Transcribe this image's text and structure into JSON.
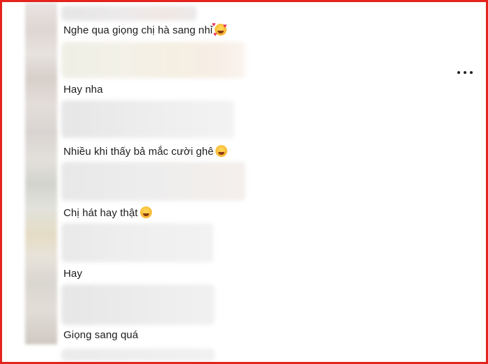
{
  "comments": [
    {
      "text": "Nghe qua giọng chị hà sang nhỉ",
      "emoji": "smiling-face-with-hearts-emoji"
    },
    {
      "text": "Hay nha",
      "emoji": ""
    },
    {
      "text": "Nhiều khi thấy bả mắc cười ghê",
      "emoji": "laughing-face-emoji"
    },
    {
      "text": "Chị hát hay thật",
      "emoji": "grinning-face-emoji"
    },
    {
      "text": "Hay",
      "emoji": ""
    },
    {
      "text": "Giọng sang quá",
      "emoji": ""
    }
  ],
  "menu": {
    "icon": "more-options-icon"
  },
  "colors": {
    "frame": "#e3231c",
    "text": "#1c1c1c"
  }
}
